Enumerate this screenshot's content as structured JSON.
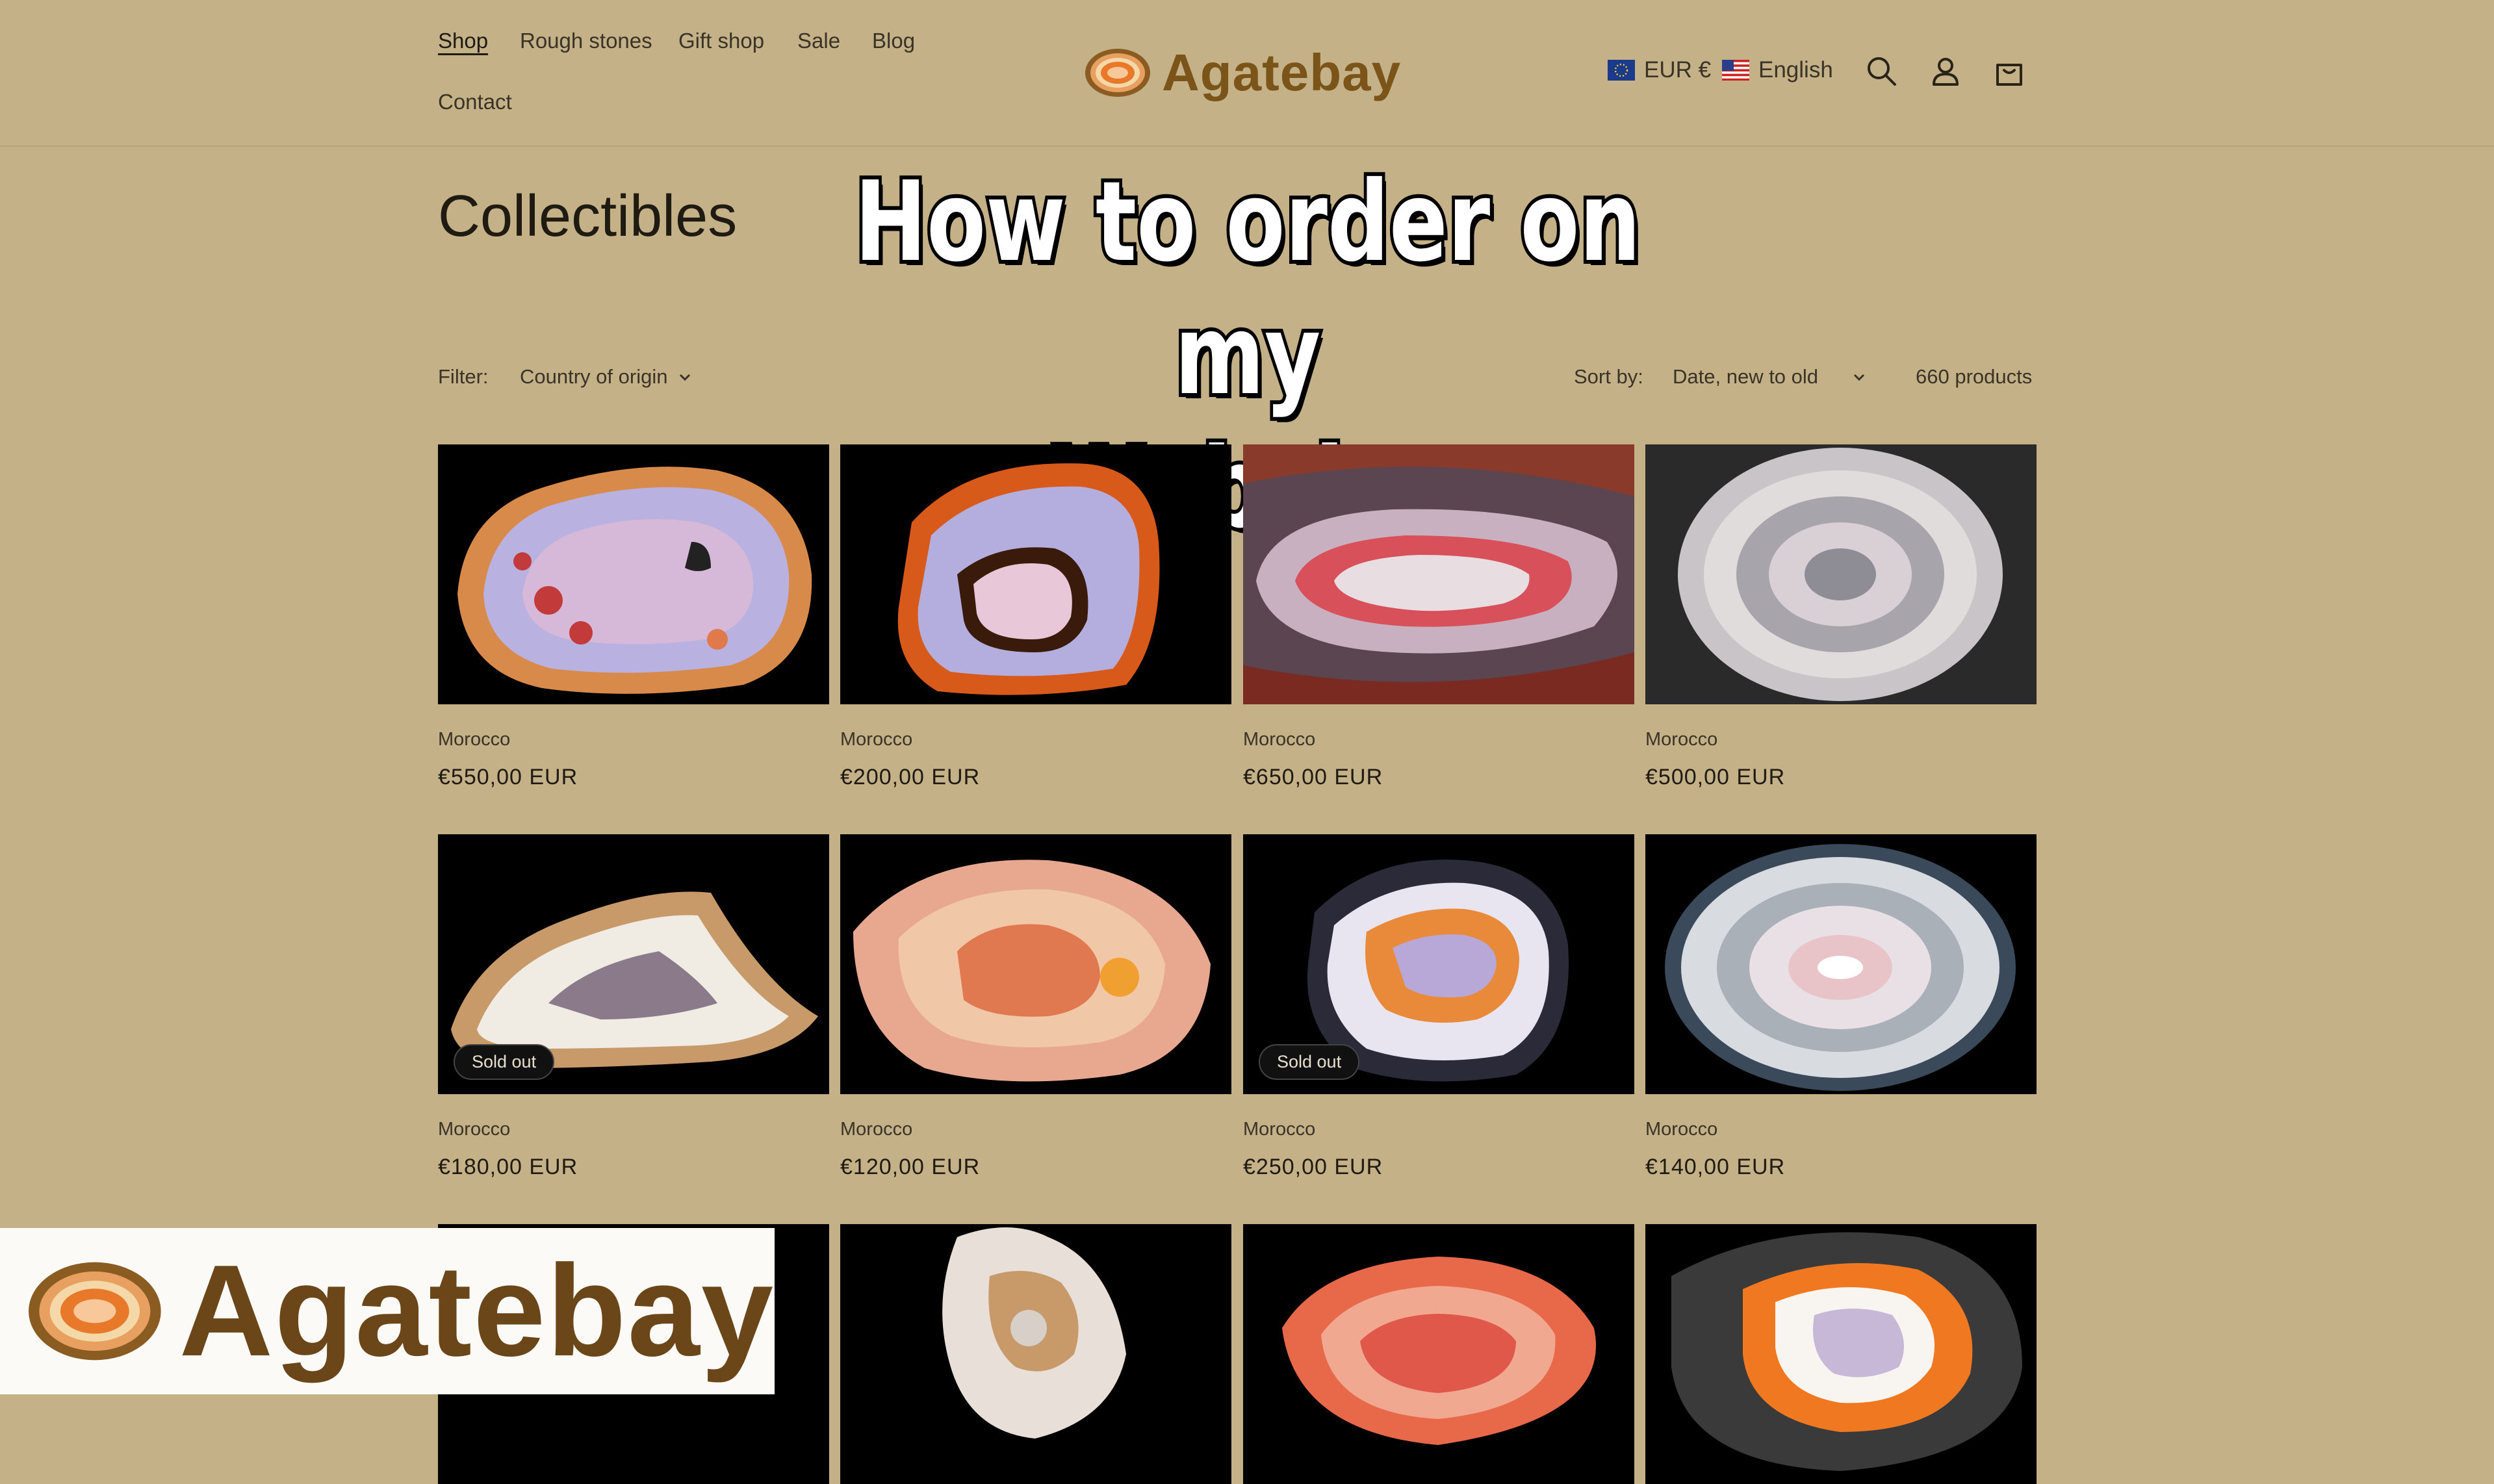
{
  "nav": {
    "items": [
      {
        "label": "Shop",
        "active": true
      },
      {
        "label": "Rough stones"
      },
      {
        "label": "Gift shop"
      },
      {
        "label": "Sale"
      },
      {
        "label": "Blog"
      },
      {
        "label": "Contact"
      }
    ]
  },
  "logo": {
    "text": "Agatebay"
  },
  "utility": {
    "currency": "EUR €",
    "language": "English",
    "icons": [
      "search-icon",
      "account-icon",
      "cart-icon"
    ]
  },
  "page": {
    "title": "Collectibles"
  },
  "overlay": {
    "line1": "How to order on my",
    "line2": "Website"
  },
  "filter": {
    "label": "Filter:",
    "option": "Country of origin"
  },
  "sort": {
    "label": "Sort by:",
    "option": "Date, new to old"
  },
  "count": "660 products",
  "products": [
    {
      "country": "Morocco",
      "price": "€550,00 EUR",
      "sold_out": false
    },
    {
      "country": "Morocco",
      "price": "€200,00 EUR",
      "sold_out": false
    },
    {
      "country": "Morocco",
      "price": "€650,00 EUR",
      "sold_out": false
    },
    {
      "country": "Morocco",
      "price": "€500,00 EUR",
      "sold_out": false
    },
    {
      "country": "Morocco",
      "price": "€180,00 EUR",
      "sold_out": true
    },
    {
      "country": "Morocco",
      "price": "€120,00 EUR",
      "sold_out": false
    },
    {
      "country": "Morocco",
      "price": "€250,00 EUR",
      "sold_out": true
    },
    {
      "country": "Morocco",
      "price": "€140,00 EUR",
      "sold_out": false
    }
  ],
  "sold_out_label": "Sold out",
  "watermark": {
    "text": "Agatebay"
  },
  "colors": {
    "background": "#c4b187",
    "brand": "#7a5418",
    "accent_orange": "#e8782a"
  }
}
